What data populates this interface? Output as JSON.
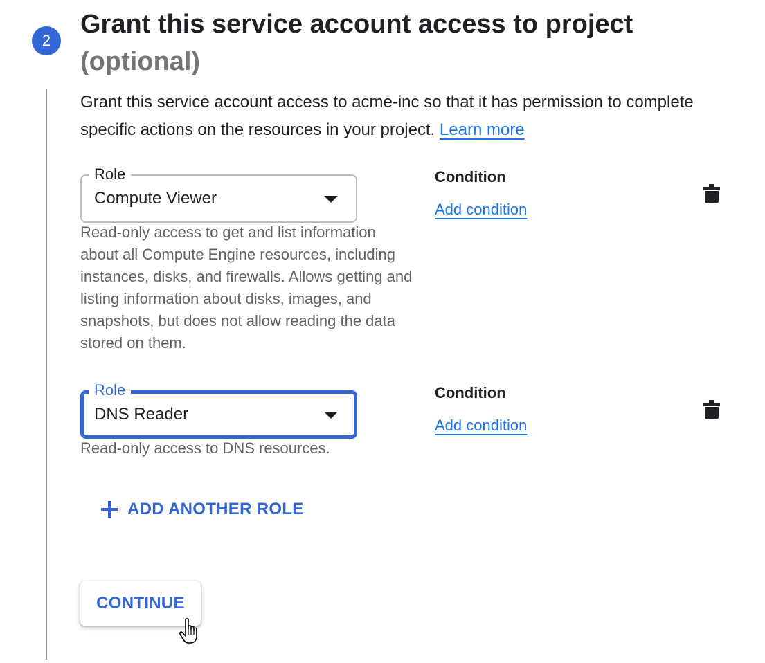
{
  "step": {
    "number": "2"
  },
  "heading": {
    "title": "Grant this service account access to project",
    "optional": "(optional)"
  },
  "description": {
    "text": "Grant this service account access to acme-inc so that it has permission to complete specific actions on the resources in your project. ",
    "learn_more": "Learn more"
  },
  "roles": [
    {
      "label": "Role",
      "value": "Compute Viewer",
      "help": "Read-only access to get and list information about all Compute Engine resources, including instances, disks, and firewalls. Allows getting and listing information about disks, images, and snapshots, but does not allow reading the data stored on them.",
      "condition_title": "Condition",
      "condition_link": "Add condition",
      "focused": false
    },
    {
      "label": "Role",
      "value": "DNS Reader",
      "help": "Read-only access to DNS resources.",
      "condition_title": "Condition",
      "condition_link": "Add condition",
      "focused": true
    }
  ],
  "add_role_label": "ADD ANOTHER ROLE",
  "continue_label": "CONTINUE",
  "icons": {
    "delete": "trash-icon",
    "add": "plus-icon",
    "dropdown": "dropdown-caret-icon",
    "cursor": "hand-pointer-cursor-icon"
  },
  "colors": {
    "accent": "#3367d6",
    "link": "#1a73e8",
    "muted": "#757575"
  }
}
